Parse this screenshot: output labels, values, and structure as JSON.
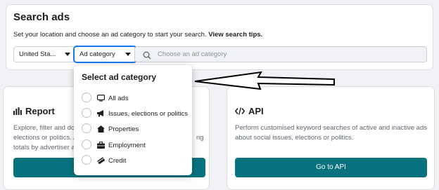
{
  "search": {
    "title": "Search ads",
    "description": "Set your location and choose an ad category to start your search.",
    "tips_link": "View search tips.",
    "country_value": "United Sta...",
    "category_value": "Ad category",
    "search_placeholder": "Choose an ad category"
  },
  "dropdown": {
    "title": "Select ad category",
    "options": [
      {
        "label": "All ads",
        "icon": "monitor-icon"
      },
      {
        "label": "Issues, elections or politics",
        "icon": "megaphone-icon"
      },
      {
        "label": "Properties",
        "icon": "house-icon"
      },
      {
        "label": "Employment",
        "icon": "briefcase-icon"
      },
      {
        "label": "Credit",
        "icon": "credit-card-icon"
      }
    ]
  },
  "report": {
    "title": "Report",
    "desc_line1": "Explore, filter and dov",
    "desc_line2": "elections or politics. A",
    "desc_line2_tail": "ng",
    "desc_line3": "totals by advertiser ar"
  },
  "api": {
    "title": "API",
    "desc_line1": "Perform customised keyword searches of active and inactive ads",
    "desc_line2": "about social issues, elections or politics.",
    "button": "Go to API"
  },
  "colors": {
    "primary": "#08737f",
    "focus": "#1877f2"
  }
}
